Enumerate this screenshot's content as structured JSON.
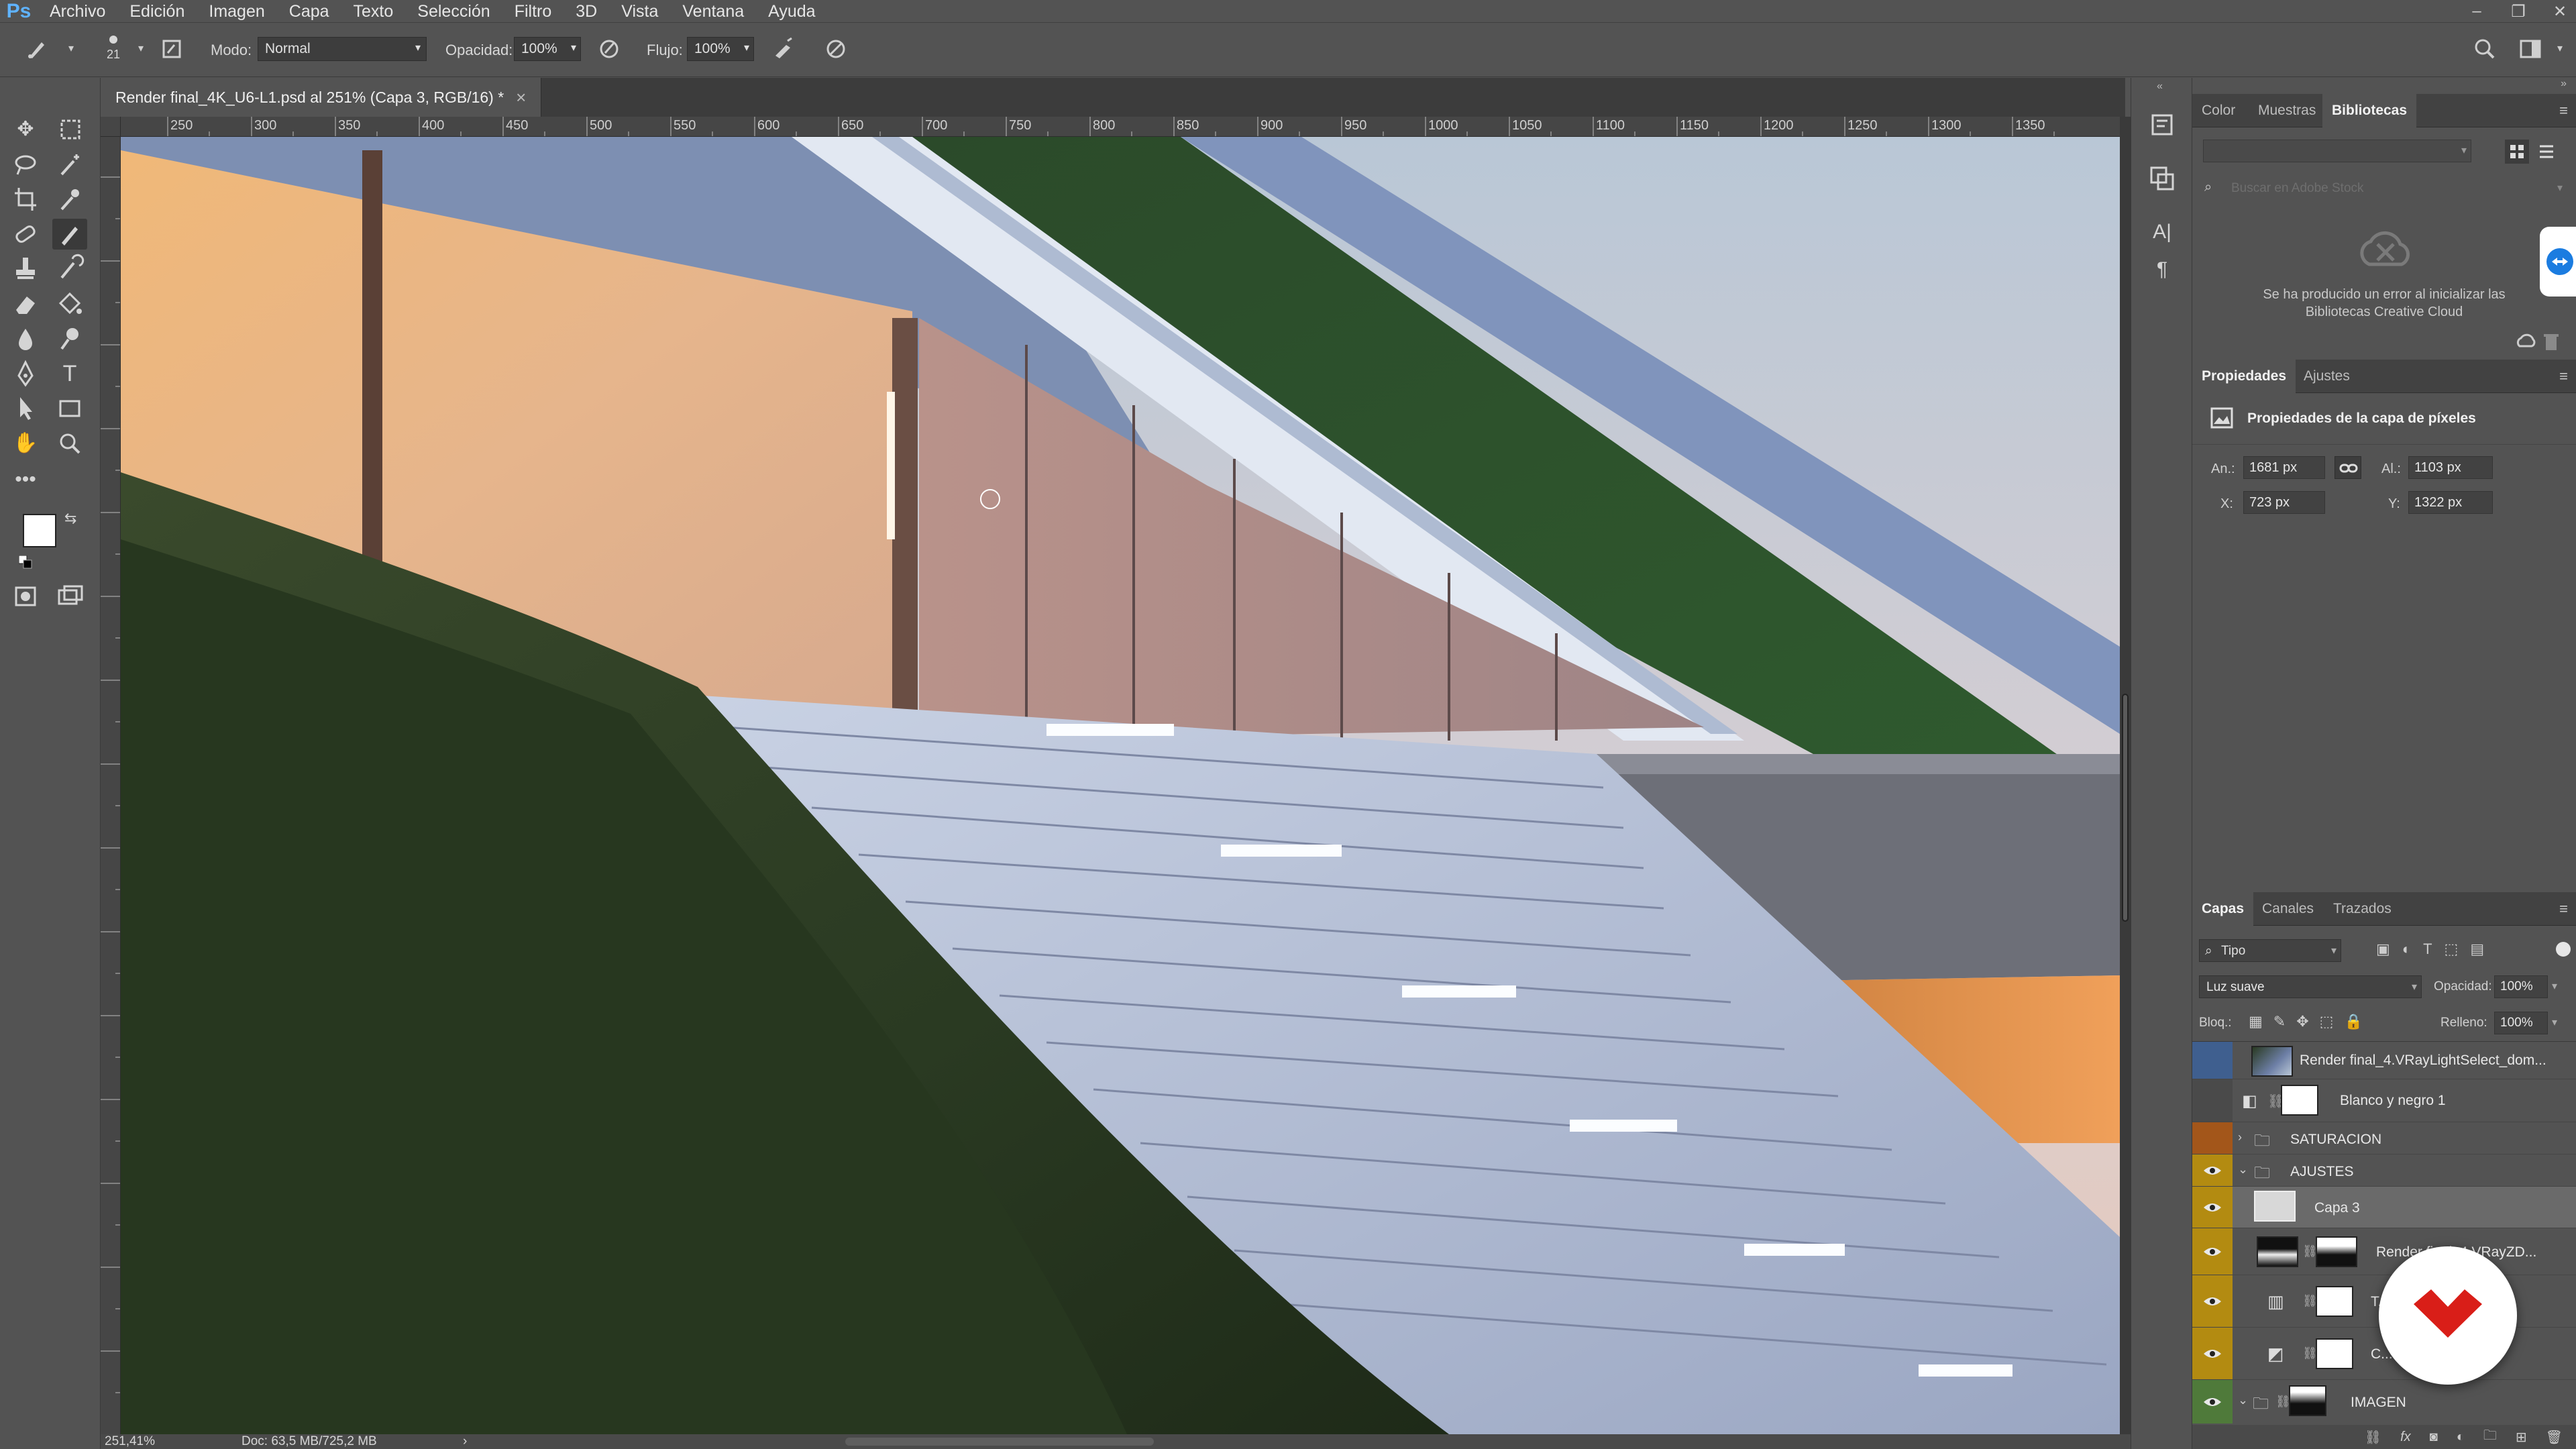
{
  "menu": [
    "Archivo",
    "Edición",
    "Imagen",
    "Capa",
    "Texto",
    "Selección",
    "Filtro",
    "3D",
    "Vista",
    "Ventana",
    "Ayuda"
  ],
  "app": {
    "logo": "Ps"
  },
  "window_controls": {
    "minimize": "–",
    "restore": "❐",
    "close": "✕"
  },
  "options": {
    "brush_size": "21",
    "mode_label": "Modo:",
    "mode_value": "Normal",
    "opacity_label": "Opacidad:",
    "opacity_value": "100%",
    "flow_label": "Flujo:",
    "flow_value": "100%"
  },
  "document": {
    "tab_title": "Render final_4K_U6-L1.psd al 251% (Capa 3, RGB/16) *",
    "tab_close": "×",
    "zoom": "251,41%",
    "doc_size": "Doc: 63,5 MB/725,2 MB",
    "ruler_h": [
      "250",
      "300",
      "350",
      "400",
      "450",
      "500",
      "550",
      "600",
      "650",
      "700",
      "750",
      "800",
      "850",
      "900",
      "950",
      "1000",
      "1050",
      "1100",
      "1150",
      "1200",
      "1250",
      "1300",
      "1350"
    ]
  },
  "libraries_panel": {
    "tabs": [
      "Color",
      "Muestras",
      "Bibliotecas"
    ],
    "active_tab": "Bibliotecas",
    "search_placeholder": "Buscar en Adobe Stock",
    "error_line1": "Se ha producido un error al inicializar las",
    "error_line2": "Bibliotecas Creative Cloud"
  },
  "properties_panel": {
    "tabs": [
      "Propiedades",
      "Ajustes"
    ],
    "active_tab": "Propiedades",
    "title": "Propiedades de la capa de píxeles",
    "width_label": "An.:",
    "width_value": "1681 px",
    "height_label": "Al.:",
    "height_value": "1103 px",
    "x_label": "X:",
    "x_value": "723 px",
    "y_label": "Y:",
    "y_value": "1322 px"
  },
  "layers_panel": {
    "tabs": [
      "Capas",
      "Canales",
      "Trazados"
    ],
    "active_tab": "Capas",
    "filter_kind": "Tipo",
    "blend_mode": "Luz suave",
    "opacity_label": "Opacidad:",
    "opacity_value": "100%",
    "lock_label": "Bloq.:",
    "fill_label": "Relleno:",
    "fill_value": "100%",
    "layers": [
      {
        "name": "Render final_4.VRayLightSelect_dom...",
        "visible": true
      },
      {
        "name": "Blanco y negro 1",
        "visible": false
      },
      {
        "name": "SATURACION",
        "visible": false
      },
      {
        "name": "AJUSTES",
        "visible": true
      },
      {
        "name": "Capa 3",
        "visible": true,
        "selected": true
      },
      {
        "name": "Render final_4.VRayZD...",
        "visible": true
      },
      {
        "name": "T...",
        "visible": true
      },
      {
        "name": "C...",
        "visible": true
      },
      {
        "name": "IMAGEN",
        "visible": true
      }
    ]
  },
  "colors": {
    "accent": "#b38b11",
    "panel": "#535353",
    "dark": "#3c3c3c",
    "watermark": "#d91e18"
  }
}
